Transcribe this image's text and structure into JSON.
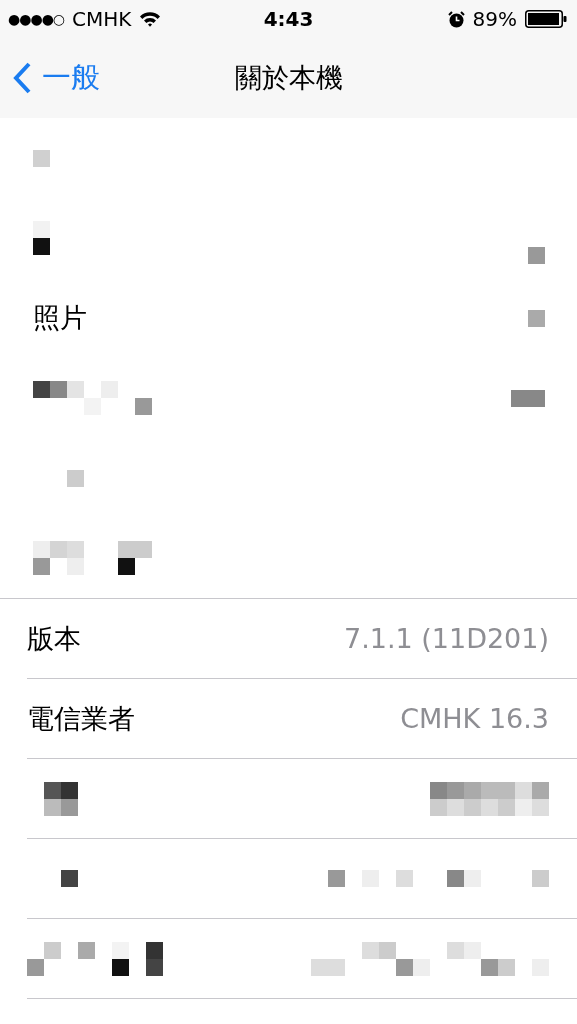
{
  "status_bar": {
    "signal": "●●●●○",
    "carrier": "CMHK",
    "time": "4:43",
    "battery": "89%"
  },
  "nav": {
    "back": "一般",
    "title": "關於本機"
  },
  "groups": [
    {
      "rows": [
        {
          "kind": "redacted"
        },
        {
          "kind": "redacted"
        },
        {
          "kind": "label",
          "label": "照片"
        },
        {
          "kind": "redacted"
        },
        {
          "kind": "redacted"
        },
        {
          "kind": "redacted"
        }
      ]
    },
    {
      "rows": [
        {
          "kind": "info",
          "label": "版本",
          "value": "7.1.1 (11D201)"
        },
        {
          "kind": "info",
          "label": "電信業者",
          "value": "CMHK 16.3"
        },
        {
          "kind": "redacted"
        },
        {
          "kind": "redacted"
        },
        {
          "kind": "redacted"
        }
      ]
    }
  ]
}
